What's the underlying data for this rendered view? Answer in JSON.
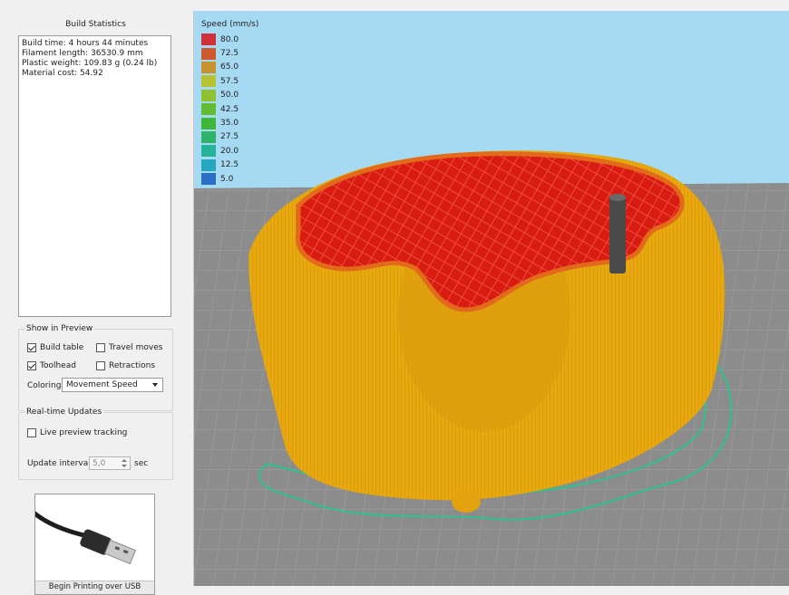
{
  "build_statistics": {
    "title": "Build Statistics",
    "lines": [
      "Build time: 4 hours 44 minutes",
      "Filament length: 36530.9 mm",
      "Plastic weight: 109.83 g (0.24 lb)",
      "Material cost: 54.92"
    ]
  },
  "show_in_preview": {
    "title": "Show in Preview",
    "build_table": {
      "label": "Build table",
      "checked": true
    },
    "travel_moves": {
      "label": "Travel moves",
      "checked": false
    },
    "toolhead": {
      "label": "Toolhead",
      "checked": true
    },
    "retractions": {
      "label": "Retractions",
      "checked": false
    },
    "coloring_label": "Coloring",
    "coloring_value": "Movement Speed"
  },
  "realtime_updates": {
    "title": "Real-time Updates",
    "live_preview": {
      "label": "Live preview tracking",
      "checked": false
    },
    "interval_label": "Update interval",
    "interval_value": "5,0",
    "interval_unit": "sec"
  },
  "usb_button": {
    "label": "Begin Printing over USB"
  },
  "legend": {
    "title": "Speed (mm/s)",
    "entries": [
      {
        "value": "80.0",
        "color": "#d0303a"
      },
      {
        "value": "72.5",
        "color": "#cc5a2e"
      },
      {
        "value": "65.0",
        "color": "#c8922e"
      },
      {
        "value": "57.5",
        "color": "#b7c332"
      },
      {
        "value": "50.0",
        "color": "#8fc232"
      },
      {
        "value": "42.5",
        "color": "#62bc33"
      },
      {
        "value": "35.0",
        "color": "#3db73a"
      },
      {
        "value": "27.5",
        "color": "#2eb36a"
      },
      {
        "value": "20.0",
        "color": "#27b39a"
      },
      {
        "value": "12.5",
        "color": "#26a7c0"
      },
      {
        "value": "5.0",
        "color": "#2a6fc6"
      }
    ]
  },
  "colors": {
    "sky": "#a6d9f2",
    "bed": "#8a8a8a",
    "print_body": "#e6a70f",
    "print_top": "#d51f12",
    "skirt": "#2fc38b",
    "toolhead": "#4a4a4a"
  }
}
